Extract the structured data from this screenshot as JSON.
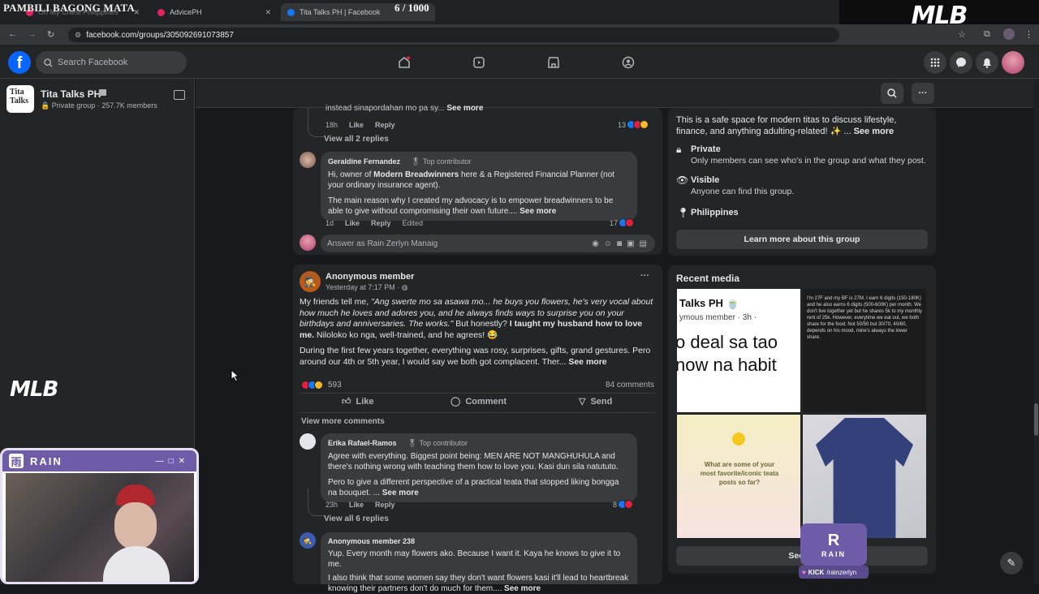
{
  "overlay": {
    "stream_title": "PAMBILI BAGONG MATA",
    "counter": "6 / 1000",
    "brand": "MLB"
  },
  "browser": {
    "tabs": [
      {
        "label": "Oh My Chest Philippines",
        "favicon_color": "#e0245e"
      },
      {
        "label": "AdvicePH",
        "favicon_color": "#e0245e"
      },
      {
        "label": "Tita Talks PH | Facebook",
        "favicon_color": "#1877f2"
      }
    ],
    "url": "facebook.com/groups/305092691073857"
  },
  "fb": {
    "search_placeholder": "Search Facebook",
    "accent": "#0866ff"
  },
  "group": {
    "name": "Tita Talks PH",
    "meta": "Private group · 257.7K members",
    "avatar_text": "Tita Talks"
  },
  "feed": {
    "top_comment": {
      "snippet": "instead sinapordahan mo pa sy...",
      "see_more": "See more",
      "time": "18h",
      "like": "Like",
      "reply": "Reply",
      "reactions": "13"
    },
    "view_replies_1": "View all 2 replies",
    "geraldine": {
      "name": "Geraldine Fernandez",
      "badge": "Top contributor",
      "p1_a": "Hi, owner of ",
      "p1_bold": "Modern Breadwinners",
      "p1_b": " here & a Registered Financial Planner (not your ordinary insurance agent).",
      "p2": "The main reason why I created my advocacy is to empower breadwinners to be able to give without compromising their own future....",
      "see_more": "See more",
      "time": "1d",
      "like": "Like",
      "reply": "Reply",
      "edited": "Edited",
      "reactions": "17"
    },
    "answer_placeholder": "Answer as Rain Zerlyn Manaig",
    "post": {
      "author": "Anonymous member",
      "time": "Yesterday at 7:17 PM ·",
      "p1_a": "My friends tell me, ",
      "p1_italic": "\"Ang swerte mo sa asawa mo... he buys you flowers, he's very vocal about how much he loves and adores you, and he always finds ways to surprise you on your birthdays and anniversaries. The works.\"",
      "p1_b": " But honestly? ",
      "p1_bold": "I taught my husband how to love me.",
      "p1_c": " Niloloko ko nga, well-trained, and he agrees! 😂",
      "p2": "During the first few years together, everything was rosy, surprises, gifts, grand gestures. Pero around our 4th or 5th year, I would say we both got complacent. Ther...",
      "see_more": "See more",
      "reactions": "593",
      "comments": "84 comments",
      "like": "Like",
      "comment": "Comment",
      "send": "Send",
      "view_more": "View more comments"
    },
    "erika": {
      "name": "Erika Rafael-Ramos",
      "badge": "Top contributor",
      "p1": "Agree with everything. Biggest point being: MEN ARE NOT MANGHUHULA and there's nothing wrong with teaching them how to love you. Kasi dun sila natututo.",
      "p2": "Pero to give a different perspective of a practical teata that stopped liking bongga na bouquet. ...",
      "see_more": "See more",
      "time": "23h",
      "like": "Like",
      "reply": "Reply",
      "reactions": "8"
    },
    "view_replies_2": "View all 6 replies",
    "anon238": {
      "name": "Anonymous member 238",
      "p1": "Yup. Every month may flowers ako. Because I want it. Kaya he knows to give it to me.",
      "p2": "I also think that some women say they don't want flowers kasi it'll lead to heartbreak knowing their partners don't do much for them....",
      "see_more": "See more"
    }
  },
  "about": {
    "desc": "This is a safe space for modern titas to discuss lifestyle, finance, and anything adulting-related! ✨ ...",
    "see_more": "See more",
    "private_title": "Private",
    "private_desc": "Only members can see who's in the group and what they post.",
    "visible_title": "Visible",
    "visible_desc": "Anyone can find this group.",
    "location": "Philippines",
    "learn_more": "Learn more about this group"
  },
  "media": {
    "title": "Recent media",
    "tile1_head": "Talks PH 🍵",
    "tile1_sub": "ymous member · 3h ·",
    "tile1_big": "o deal sa tao now na habit",
    "tile2_text": "I'm 27F and my BF is 27M. I earn 6 digits (150-180K) and he also earns 6 digits (500-600K) per month. We don't live together yet but he shares 5k to my monthly rent of 25k. However, everytime we eat out, we both share for the food. Not 50/50 but 30/70, 40/60, depends on his mood, mine's always the lower share.",
    "tile3_text": "What are some of your most favorite/iconic teata posts so far?",
    "see_all": "See all"
  },
  "webcam": {
    "channel": "RAIN",
    "kick_handle": "/rainzerlyn",
    "kick_label": "KICK",
    "kick_brand": "RAIN"
  }
}
